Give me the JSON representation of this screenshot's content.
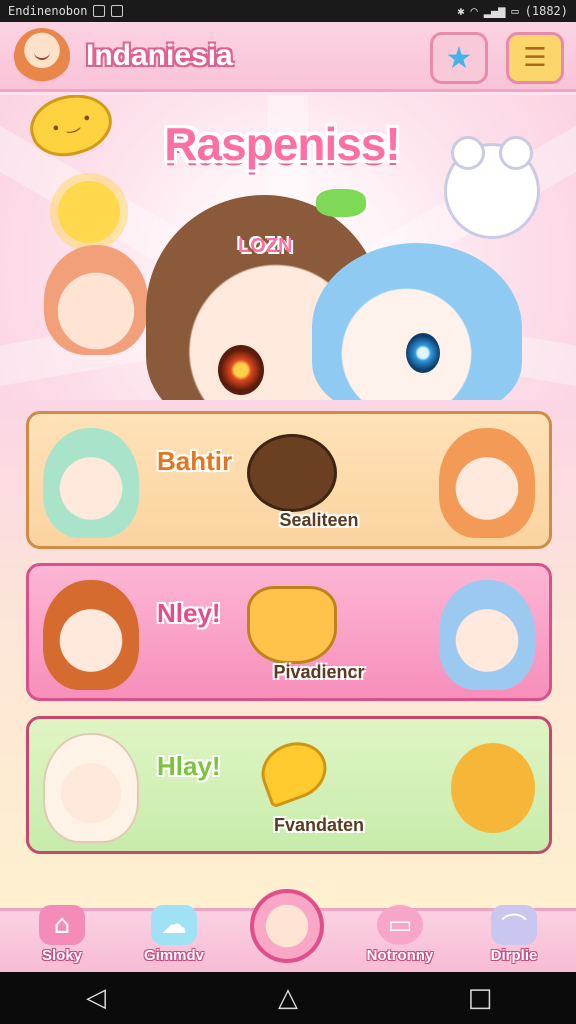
{
  "status_bar": {
    "left_text": "Endinenobon",
    "right_text": "(1882)"
  },
  "header": {
    "title": "Indaniesia",
    "star_icon": "star-icon",
    "menu_icon": "scroll-menu-icon"
  },
  "hero": {
    "title": "Raspeniss!",
    "logo_text": "LOZN"
  },
  "cards": [
    {
      "title": "Bahtir",
      "subtitle": "Sealiteen",
      "accent": "#e4761f"
    },
    {
      "title": "Nley!",
      "subtitle": "Pivadiencr",
      "accent": "#e54c8e"
    },
    {
      "title": "Hlay!",
      "subtitle": "Fvandaten",
      "accent": "#7cc43c"
    }
  ],
  "bottom_nav": {
    "items": [
      {
        "label": "Sloky",
        "icon": "house-icon"
      },
      {
        "label": "Gimmdv",
        "icon": "pet-icon"
      },
      {
        "label": "",
        "icon": "avatar-center-icon"
      },
      {
        "label": "Notronny",
        "icon": "device-icon"
      },
      {
        "label": "Dirplie",
        "icon": "shoe-icon"
      }
    ]
  },
  "system_nav": {
    "back": "◁",
    "home": "△",
    "recents": "□"
  }
}
